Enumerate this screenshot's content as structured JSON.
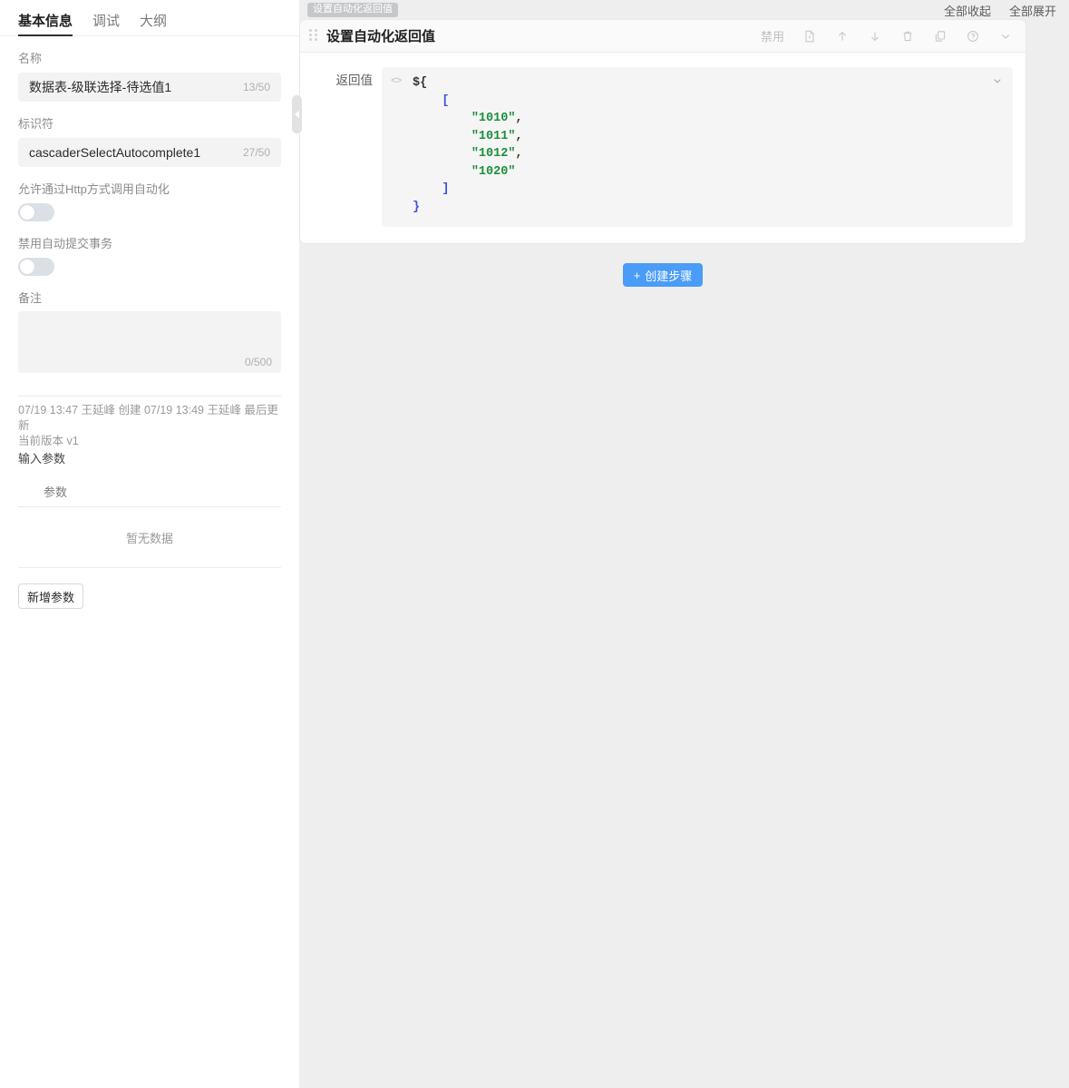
{
  "left_panel": {
    "tabs": [
      {
        "label": "基本信息",
        "active": true
      },
      {
        "label": "调试",
        "active": false
      },
      {
        "label": "大纲",
        "active": false
      }
    ],
    "fields": {
      "name_label": "名称",
      "name_value": "数据表-级联选择-待选值1",
      "name_counter": "13/50",
      "identifier_label": "标识符",
      "identifier_value": "cascaderSelectAutocomplete1",
      "identifier_counter": "27/50",
      "http_toggle_label": "允许通过Http方式调用自动化",
      "http_toggle_state": "off",
      "disable_autocommit_label": "禁用自动提交事务",
      "disable_autocommit_state": "off",
      "remark_label": "备注",
      "remark_value": "",
      "remark_placeholder": "",
      "remark_counter": "0/500"
    },
    "meta": {
      "history": "07/19 13:47 王延峰 创建 07/19 13:49 王延峰 最后更新",
      "version": "当前版本 v1"
    },
    "params": {
      "section_title": "输入参数",
      "column_header": "参数",
      "empty_text": "暂无数据",
      "add_button": "新增参数"
    }
  },
  "right_panel": {
    "topbar": {
      "collapse_all": "全部收起",
      "expand_all": "全部展开"
    },
    "badge_tip": "设置自动化返回值",
    "step": {
      "title": "设置自动化返回值",
      "disable_label": "禁用",
      "actions": [
        {
          "name": "note-icon"
        },
        {
          "name": "arrow-up-icon"
        },
        {
          "name": "arrow-down-icon"
        },
        {
          "name": "trash-icon"
        },
        {
          "name": "copy-icon"
        },
        {
          "name": "help-circle-icon"
        },
        {
          "name": "chevron-down-icon"
        }
      ],
      "return_label": "返回值",
      "code_icon": "<>",
      "code_lines": [
        {
          "indent": 0,
          "tokens": [
            {
              "t": "${",
              "c": "plain"
            }
          ]
        },
        {
          "indent": 1,
          "tokens": [
            {
              "t": "[",
              "c": "punct"
            }
          ]
        },
        {
          "indent": 2,
          "tokens": [
            {
              "t": "\"1010\"",
              "c": "string"
            },
            {
              "t": ",",
              "c": "comma"
            }
          ]
        },
        {
          "indent": 2,
          "tokens": [
            {
              "t": "\"1011\"",
              "c": "string"
            },
            {
              "t": ",",
              "c": "comma"
            }
          ]
        },
        {
          "indent": 2,
          "tokens": [
            {
              "t": "\"1012\"",
              "c": "string"
            },
            {
              "t": ",",
              "c": "comma"
            }
          ]
        },
        {
          "indent": 2,
          "tokens": [
            {
              "t": "\"1020\"",
              "c": "string"
            }
          ]
        },
        {
          "indent": 1,
          "tokens": [
            {
              "t": "]",
              "c": "punct"
            }
          ]
        },
        {
          "indent": 0,
          "tokens": [
            {
              "t": "}",
              "c": "punct"
            }
          ]
        }
      ]
    },
    "create_step_button": "创建步骤",
    "create_step_plus": "+"
  },
  "colors": {
    "primary": "#4a9cf8",
    "canvas_bg": "#eeeeee",
    "card_bg": "#ffffff",
    "field_bg": "#f3f3f4",
    "code_bg": "#f5f5f5",
    "string_token": "#1a8f3c",
    "punct_token": "#3b50d4",
    "toggle_off": "#dcdfe6"
  }
}
